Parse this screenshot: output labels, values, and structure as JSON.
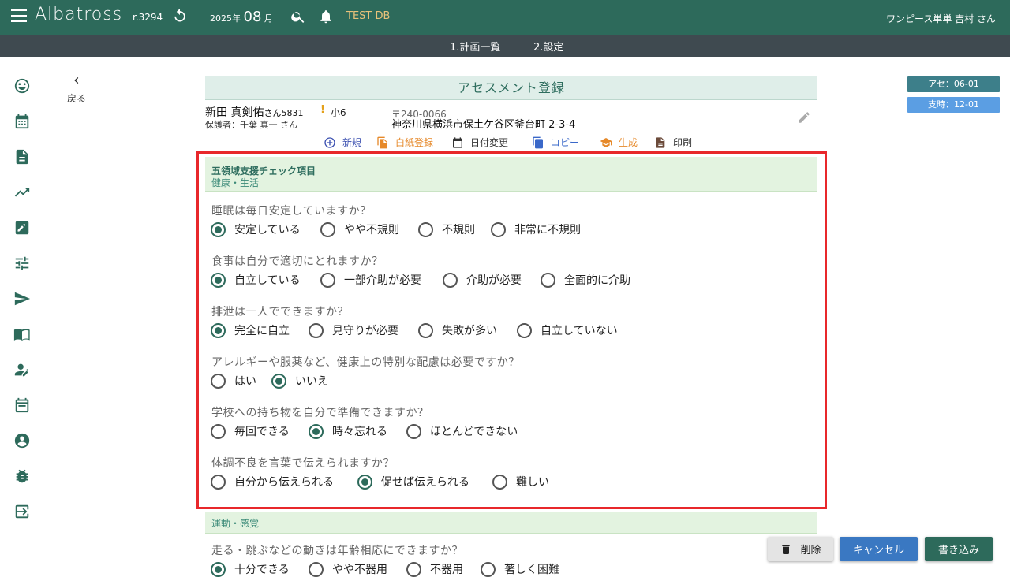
{
  "header": {
    "logo": "Albatross",
    "revision": "r.3294",
    "date_year": "2025年",
    "date_month": "08",
    "date_month_suffix": "月",
    "db_label": "TEST DB",
    "user": "ワンピース単単 吉村 さん"
  },
  "subnav": {
    "tabs": [
      "1.計画一覧",
      "2.設定"
    ]
  },
  "sidenav": {
    "icons": [
      "smile-icon",
      "calendar-icon",
      "document-icon",
      "trending-up-icon",
      "edit-note-icon",
      "tune-icon",
      "send-icon",
      "book-icon",
      "person-edit-icon",
      "event-icon",
      "account-circle-icon",
      "bug-icon",
      "login-icon"
    ]
  },
  "back": {
    "label": "戻る"
  },
  "tags": {
    "assessment": "アセ：06-01",
    "support": "支時：12-01"
  },
  "page_title": "アセスメント登録",
  "person": {
    "name": "新田 真剣佑",
    "honorific_id": "さん5831",
    "warn_mark": "!",
    "grade": "小6",
    "guardian": "保護者：千葉 真一 さん",
    "zip": "〒240-0066",
    "address": "神奈川県横浜市保土ケ谷区釜台町 2-3-4"
  },
  "actions": {
    "new": "新規",
    "blank": "白紙登録",
    "date_change": "日付変更",
    "copy": "コピー",
    "generate": "生成",
    "print": "印刷"
  },
  "section1": {
    "title": "五領域支援チェック項目",
    "subtitle": "健康・生活",
    "questions": [
      {
        "text": "睡眠は毎日安定していますか？",
        "options": [
          "安定している",
          "やや不規則",
          "不規則",
          "非常に不規則"
        ],
        "selected": 0
      },
      {
        "text": "食事は自分で適切にとれますか？",
        "options": [
          "自立している",
          "一部介助が必要",
          "介助が必要",
          "全面的に介助"
        ],
        "selected": 0
      },
      {
        "text": "排泄は一人でできますか？",
        "options": [
          "完全に自立",
          "見守りが必要",
          "失敗が多い",
          "自立していない"
        ],
        "selected": 0
      },
      {
        "text": "アレルギーや服薬など、健康上の特別な配慮は必要ですか？",
        "options": [
          "はい",
          "いいえ"
        ],
        "selected": 1
      },
      {
        "text": "学校への持ち物を自分で準備できますか？",
        "options": [
          "毎回できる",
          "時々忘れる",
          "ほとんどできない"
        ],
        "selected": 1
      },
      {
        "text": "体調不良を言葉で伝えられますか？",
        "options": [
          "自分から伝えられる",
          "促せば伝えられる",
          "難しい"
        ],
        "selected": 1
      }
    ]
  },
  "section2": {
    "subtitle": "運動・感覚",
    "questions": [
      {
        "text": "走る・跳ぶなどの動きは年齢相応にできますか？",
        "options": [
          "十分できる",
          "やや不器用",
          "不器用",
          "著しく困難"
        ],
        "selected": 0
      }
    ]
  },
  "buttons": {
    "delete": "削除",
    "cancel": "キャンセル",
    "save": "書き込み"
  },
  "colors": {
    "primary": "#2d6a5b",
    "subnav": "#3f4a50",
    "highlight_border": "#e8282b",
    "accent_orange": "#e6892a",
    "accent_blue": "#3a68c9"
  }
}
